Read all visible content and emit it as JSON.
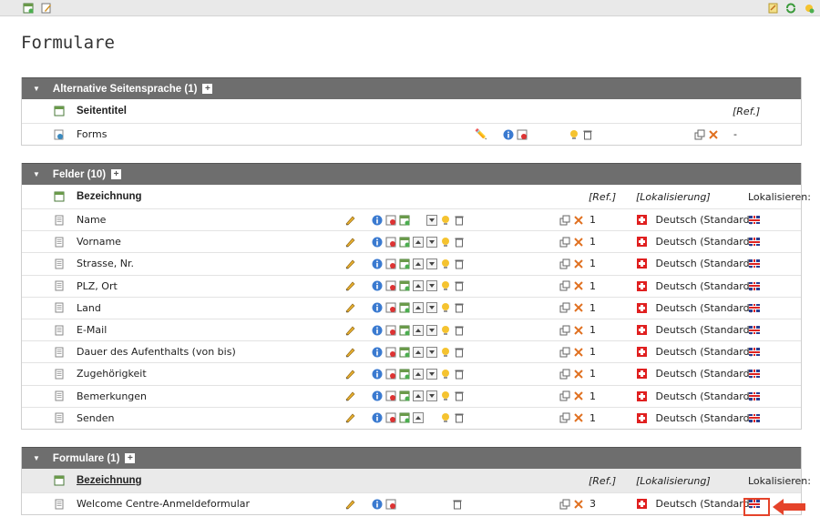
{
  "toolbar": {
    "left_icons": [
      "new-record-icon",
      "edit-page-icon"
    ],
    "right_icons": [
      "clipboard-icon",
      "refresh-icon",
      "new-content-icon"
    ]
  },
  "page": {
    "title": "Formulare"
  },
  "sections": {
    "alt": {
      "title": "Alternative Seitensprache (1)",
      "col_title": "Seitentitel",
      "col_ref": "[Ref.]",
      "rows": [
        {
          "label": "Forms",
          "ref": "-"
        }
      ]
    },
    "felder": {
      "title": "Felder (10)",
      "col_title": "Bezeichnung",
      "col_ref": "[Ref.]",
      "col_loc": "[Lokalisierung]",
      "col_localize": "Lokalisieren:",
      "rows": [
        {
          "label": "Name",
          "ref": "1",
          "lang": "Deutsch (Standard)"
        },
        {
          "label": "Vorname",
          "ref": "1",
          "lang": "Deutsch (Standard)"
        },
        {
          "label": "Strasse, Nr.",
          "ref": "1",
          "lang": "Deutsch (Standard)"
        },
        {
          "label": "PLZ, Ort",
          "ref": "1",
          "lang": "Deutsch (Standard)"
        },
        {
          "label": "Land",
          "ref": "1",
          "lang": "Deutsch (Standard)"
        },
        {
          "label": "E-Mail",
          "ref": "1",
          "lang": "Deutsch (Standard)"
        },
        {
          "label": "Dauer des Aufenthalts (von bis)",
          "ref": "1",
          "lang": "Deutsch (Standard)"
        },
        {
          "label": "Zugehörigkeit",
          "ref": "1",
          "lang": "Deutsch (Standard)"
        },
        {
          "label": "Bemerkungen",
          "ref": "1",
          "lang": "Deutsch (Standard)"
        },
        {
          "label": "Senden",
          "ref": "1",
          "lang": "Deutsch (Standard)"
        }
      ]
    },
    "formulare": {
      "title": "Formulare (1)",
      "col_title": "Bezeichnung",
      "col_ref": "[Ref.]",
      "col_loc": "[Lokalisierung]",
      "col_localize": "Lokalisieren:",
      "rows": [
        {
          "label": "Welcome Centre-Anmeldeformular",
          "ref": "3",
          "lang": "Deutsch (Standard)"
        }
      ]
    }
  },
  "colors": {
    "section_header": "#6e6e6e",
    "highlight": "#e5432a",
    "flag_ch": "#e02020"
  }
}
